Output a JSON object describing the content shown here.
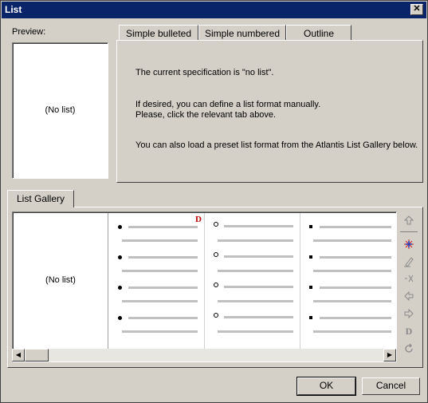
{
  "window": {
    "title": "List",
    "close_label": "✕"
  },
  "preview": {
    "label": "Preview:",
    "text": "(No list)"
  },
  "tabs": [
    {
      "label": "Simple bulleted"
    },
    {
      "label": "Simple numbered"
    },
    {
      "label": "Outline"
    }
  ],
  "info": {
    "line1": "The current specification is \"no list\".",
    "line2": "If desired, you can define a list format manually.",
    "line3": "Please, click the relevant tab above.",
    "line4": "You can also load a preset list format from the Atlantis List Gallery below."
  },
  "gallery": {
    "tab_label": "List Gallery",
    "no_list_text": "(No list)",
    "default_marker": "D",
    "columns": [
      {
        "bullet": "filled-circle"
      },
      {
        "bullet": "hollow-circle"
      },
      {
        "bullet": "filled-square"
      }
    ]
  },
  "scrollbar": {
    "left_arrow": "◀",
    "right_arrow": "▶"
  },
  "toolbar": {
    "icons": [
      "arrow-up-icon",
      "new-list-icon",
      "edit-icon",
      "cut-icon",
      "arrow-left-icon",
      "arrow-right-icon",
      "set-default-icon",
      "refresh-icon"
    ],
    "default_letter": "D"
  },
  "buttons": {
    "ok": "OK",
    "cancel": "Cancel"
  }
}
